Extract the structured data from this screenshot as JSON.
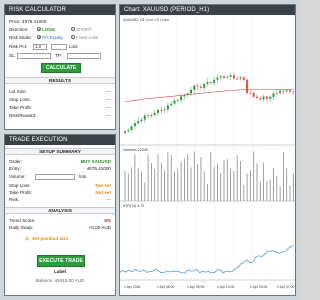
{
  "risk_calculator": {
    "title": "RISK CALCULATOR",
    "price_label": "Price: 4676.41000",
    "direction_label": "Direction:",
    "direction_long": "LONG",
    "direction_short": "SHORT",
    "risk_mode_label": "Risk Mode:",
    "risk_mode_pct": "Pct Equity",
    "risk_mode_fixed": "Fixed Loss",
    "risk_pct_label": "Risk Pct:",
    "risk_pct_value": "1.0",
    "lots_label": "Lots",
    "sl_label": "SL:",
    "tp_label": "TP:",
    "calculate_label": "CALCULATE",
    "results_header": "RESULTS",
    "results": [
      {
        "label": "Lot Size:",
        "value": "---"
      },
      {
        "label": "Stop Loss:",
        "value": "---"
      },
      {
        "label": "Take Profit:",
        "value": "---"
      },
      {
        "label": "Risk/Reward:",
        "value": "---"
      }
    ]
  },
  "trade_execution": {
    "title": "TRADE EXECUTION",
    "setup_header": "SETUP SUMMARY",
    "order_label": "Order:",
    "order_value": "BUY XAUUSD",
    "entry_label": "Entry:",
    "entry_value": "4676.41000",
    "volume_label": "Volume:",
    "volume_unit": "lots",
    "stop_loss_label": "Stop Loss:",
    "stop_loss_value": "Not set",
    "take_profit_label": "Take Profit:",
    "take_profit_value": "Not set",
    "risk_label": "Risk:",
    "risk_value": "---",
    "analysis_header": "ANALYSIS",
    "trend_score_label": "Trend Score:",
    "trend_score_value": "8%",
    "daily_swap_label": "Daily Swap:",
    "daily_swap_value": "+0.00 AUD",
    "warning_text": "Set position size",
    "execute_label": "EXECUTE TRADE",
    "bottom_label": "Label",
    "balance_text": "Balance: 49415.00 AUD"
  },
  "chart": {
    "title": "Chart: XAUUSD (PERIOD_H1)",
    "symbol_label": "XAUUSD, H1",
    "symbol_desc": "Gold US Dollar",
    "volume_label": "Volumes 22345",
    "atr_label": "ATR(14) 4.72",
    "x_ticks": [
      "1 Apr 2026",
      "1 Apr 05:00",
      "1 Apr 09:00",
      "1 Apr 13:00",
      "2 Apr 03:00",
      "2 Apr 07:00"
    ],
    "colors": {
      "bull": "#2e9b3c",
      "bear": "#e84a4a",
      "ma": "#d24848",
      "atr": "#3a90d8",
      "volume": "#8a8a8a"
    }
  }
}
